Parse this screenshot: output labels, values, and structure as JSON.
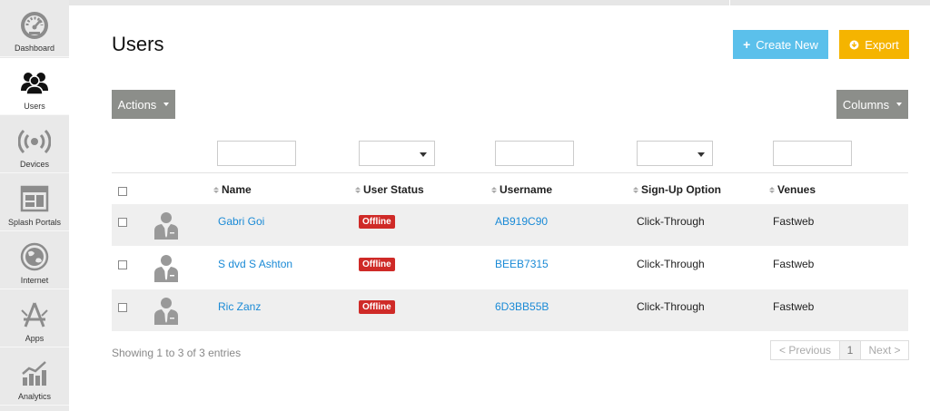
{
  "sidebar": {
    "items": [
      {
        "label": "Dashboard",
        "icon": "dashboard-icon",
        "active": false
      },
      {
        "label": "Users",
        "icon": "users-icon",
        "active": true
      },
      {
        "label": "Devices",
        "icon": "devices-icon",
        "active": false
      },
      {
        "label": "Splash Portals",
        "icon": "splash-portals-icon",
        "active": false
      },
      {
        "label": "Internet",
        "icon": "globe-icon",
        "active": false
      },
      {
        "label": "Apps",
        "icon": "apps-icon",
        "active": false
      },
      {
        "label": "Analytics",
        "icon": "analytics-icon",
        "active": false
      }
    ]
  },
  "header": {
    "title": "Users",
    "create_label": "Create New",
    "export_label": "Export"
  },
  "toolbar": {
    "actions_label": "Actions",
    "columns_label": "Columns"
  },
  "table": {
    "columns": [
      "Name",
      "User Status",
      "Username",
      "Sign-Up Option",
      "Venues"
    ],
    "rows": [
      {
        "name": "Gabri Goi",
        "status": "Offline",
        "username": "AB919C90",
        "signup": "Click-Through",
        "venue": "Fastweb"
      },
      {
        "name": "S dvd S Ashton",
        "status": "Offline",
        "username": "BEEB7315",
        "signup": "Click-Through",
        "venue": "Fastweb"
      },
      {
        "name": "Ric Zanz",
        "status": "Offline",
        "username": "6D3BB55B",
        "signup": "Click-Through",
        "venue": "Fastweb"
      }
    ],
    "info": "Showing 1 to 3 of 3 entries"
  },
  "pagination": {
    "previous": "< Previous",
    "current": "1",
    "next": "Next >"
  },
  "colors": {
    "create": "#5bc0eb",
    "export": "#f5b400",
    "offline": "#cf2a27",
    "link": "#1a8ad6"
  }
}
